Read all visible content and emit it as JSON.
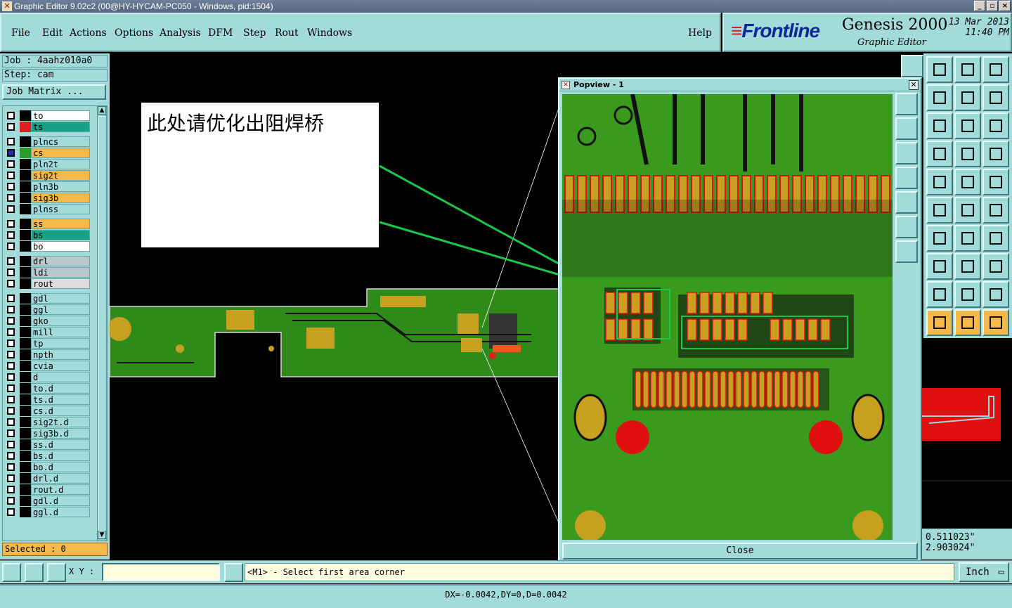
{
  "window": {
    "title": "Graphic Editor 9.02c2 (00@HY-HYCAM-PC050 - Windows, pid:1504)"
  },
  "menu": {
    "file": "File",
    "edit": "Edit",
    "actions": "Actions",
    "options": "Options",
    "analysis": "Analysis",
    "dfm": "DFM",
    "step": "Step",
    "rout": "Rout",
    "windows": "Windows",
    "help": "Help"
  },
  "brand": {
    "logo": "Frontline",
    "product": "Genesis 2000",
    "subtitle": "Graphic Editor",
    "date": "13 Mar 2013",
    "time": "11:40 PM"
  },
  "job": {
    "job_line": "Job : 4aahz010a0",
    "step_line": "Step: cam",
    "matrix_button": "Job Matrix ..."
  },
  "layers": [
    {
      "name": "to",
      "color": "#ffffff",
      "swatch": "#000000"
    },
    {
      "name": "ts",
      "color": "#17a085",
      "swatch": "#e02020"
    },
    {
      "name": "plncs",
      "color": "#a3dada",
      "swatch": "#000000"
    },
    {
      "name": "cs",
      "color": "#f5b84a",
      "swatch": "#2a9a2a",
      "active": true
    },
    {
      "name": "pln2t",
      "color": "#a3dada",
      "swatch": "#000000"
    },
    {
      "name": "sig2t",
      "color": "#f5b84a",
      "swatch": "#000000"
    },
    {
      "name": "pln3b",
      "color": "#a3dada",
      "swatch": "#000000"
    },
    {
      "name": "sig3b",
      "color": "#f5b84a",
      "swatch": "#000000"
    },
    {
      "name": "plnss",
      "color": "#a3dada",
      "swatch": "#000000"
    },
    {
      "name": "ss",
      "color": "#f5b84a",
      "swatch": "#000000"
    },
    {
      "name": "bs",
      "color": "#17a085",
      "swatch": "#000000"
    },
    {
      "name": "bo",
      "color": "#ffffff",
      "swatch": "#000000"
    },
    {
      "name": "drl",
      "color": "#b8c8cc",
      "swatch": "#000000"
    },
    {
      "name": "ldi",
      "color": "#b8c8cc",
      "swatch": "#000000"
    },
    {
      "name": "rout",
      "color": "#dcdcdc",
      "swatch": "#000000"
    },
    {
      "name": "gdl",
      "color": "#a3dada",
      "swatch": "#000000"
    },
    {
      "name": "ggl",
      "color": "#a3dada",
      "swatch": "#000000"
    },
    {
      "name": "gko",
      "color": "#a3dada",
      "swatch": "#000000"
    },
    {
      "name": "mill",
      "color": "#a3dada",
      "swatch": "#000000"
    },
    {
      "name": "tp",
      "color": "#a3dada",
      "swatch": "#000000"
    },
    {
      "name": "npth",
      "color": "#a3dada",
      "swatch": "#000000"
    },
    {
      "name": "cvia",
      "color": "#a3dada",
      "swatch": "#000000"
    },
    {
      "name": "d",
      "color": "#a3dada",
      "swatch": "#000000"
    },
    {
      "name": "to.d",
      "color": "#a3dada",
      "swatch": "#000000"
    },
    {
      "name": "ts.d",
      "color": "#a3dada",
      "swatch": "#000000"
    },
    {
      "name": "cs.d",
      "color": "#a3dada",
      "swatch": "#000000"
    },
    {
      "name": "sig2t.d",
      "color": "#a3dada",
      "swatch": "#000000"
    },
    {
      "name": "sig3b.d",
      "color": "#a3dada",
      "swatch": "#000000"
    },
    {
      "name": "ss.d",
      "color": "#a3dada",
      "swatch": "#000000"
    },
    {
      "name": "bs.d",
      "color": "#a3dada",
      "swatch": "#000000"
    },
    {
      "name": "bo.d",
      "color": "#a3dada",
      "swatch": "#000000"
    },
    {
      "name": "drl.d",
      "color": "#a3dada",
      "swatch": "#000000"
    },
    {
      "name": "rout.d",
      "color": "#a3dada",
      "swatch": "#000000"
    },
    {
      "name": "gdl.d",
      "color": "#a3dada",
      "swatch": "#000000"
    },
    {
      "name": "ggl.d",
      "color": "#a3dada",
      "swatch": "#000000"
    }
  ],
  "selected": "Selected : 0",
  "annotation": {
    "text": "此处请优化出阻焊桥"
  },
  "popview": {
    "title": "Popview - 1",
    "close_label": "Close"
  },
  "coords": {
    "x": "0.511023\"",
    "y": "2.903024\""
  },
  "bottom": {
    "xy_label": "X Y :",
    "xy_value": "",
    "prompt": "<M1> - Select first area corner",
    "units": "Inch"
  },
  "status": {
    "text": "DX=-0.0042,DY=0,D=0.0042"
  },
  "colors": {
    "panel": "#a3dada",
    "board_green": "#3a9a1e",
    "pad_gold": "#c8a020",
    "pad_red": "#e01010",
    "highlight": "#17c84a"
  }
}
